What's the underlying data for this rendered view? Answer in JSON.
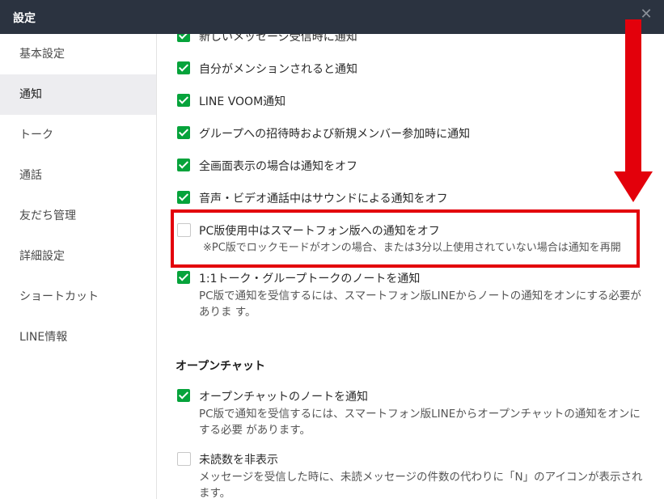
{
  "window": {
    "title": "設定",
    "close_glyph": "✕"
  },
  "sidebar": {
    "items": [
      {
        "label": "基本設定"
      },
      {
        "label": "通知",
        "active": true
      },
      {
        "label": "トーク"
      },
      {
        "label": "通話"
      },
      {
        "label": "友だち管理"
      },
      {
        "label": "詳細設定"
      },
      {
        "label": "ショートカット"
      },
      {
        "label": "LINE情報"
      }
    ]
  },
  "notifications": {
    "options": [
      {
        "label": "新しいメッセージ受信時に通知",
        "checked": true
      },
      {
        "label": "自分がメンションされると通知",
        "checked": true
      },
      {
        "label": "LINE VOOM通知",
        "checked": true
      },
      {
        "label": "グループへの招待時および新規メンバー参加時に通知",
        "checked": true
      },
      {
        "label": "全画面表示の場合は通知をオフ",
        "checked": true
      },
      {
        "label": "音声・ビデオ通話中はサウンドによる通知をオフ",
        "checked": true
      },
      {
        "label": "PC版使用中はスマートフォン版への通知をオフ",
        "sub": "※PC版でロックモードがオンの場合、または3分以上使用されていない場合は通知を再開",
        "checked": false
      },
      {
        "label": "1:1トーク・グループトークのノートを通知",
        "sub": "PC版で通知を受信するには、スマートフォン版LINEからノートの通知をオンにする必要がありま す。",
        "checked": true
      }
    ]
  },
  "open_chat": {
    "section_title": "オープンチャット",
    "options": [
      {
        "label": "オープンチャットのノートを通知",
        "sub": "PC版で通知を受信するには、スマートフォン版LINEからオープンチャットの通知をオンにする必要 があります。",
        "checked": true
      },
      {
        "label": "未読数を非表示",
        "sub": "メッセージを受信した時に、未読メッセージの件数の代わりに「N」のアイコンが表示されます。",
        "checked": false
      }
    ]
  },
  "annotation_color": "#e3000b",
  "accent_color": "#06a33b"
}
